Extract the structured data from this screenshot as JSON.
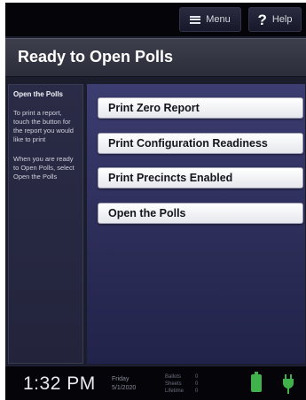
{
  "topbar": {
    "menu_label": "Menu",
    "help_label": "Help"
  },
  "title": "Ready to Open Polls",
  "sidebar": {
    "heading": "Open the Polls",
    "paragraphs": [
      "To print a report, touch the button for the report you would like to print",
      "When you are ready to Open Polls, select Open the Polls"
    ]
  },
  "actions": [
    "Print Zero Report",
    "Print Configuration Readiness",
    "Print Precincts Enabled",
    "Open the Polls"
  ],
  "statusbar": {
    "time": "1:32 PM",
    "day": "Friday",
    "date": "5/1/2020",
    "counts": [
      {
        "label": "Ballots",
        "value": "0"
      },
      {
        "label": "Sheets",
        "value": "0"
      },
      {
        "label": "Lifetime",
        "value": "0"
      }
    ]
  },
  "colors": {
    "battery": "#3fb34a",
    "plug": "#3fb34a",
    "content_panel": "#3c3d70",
    "button_background": "#ffffff"
  },
  "icons": {
    "menu": "hamburger-icon",
    "help": "question-mark-icon",
    "battery": "battery-icon",
    "power": "power-plug-icon"
  }
}
